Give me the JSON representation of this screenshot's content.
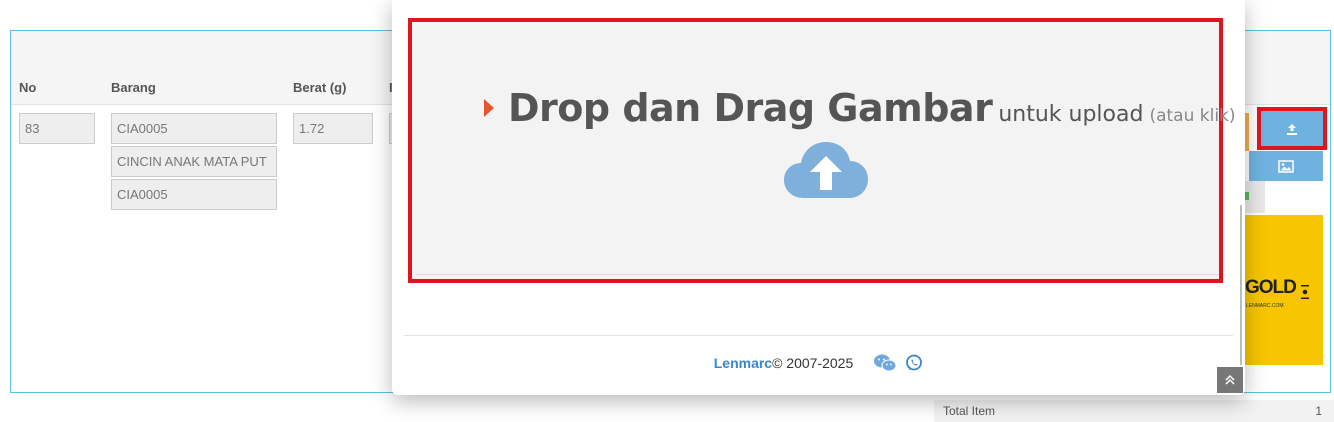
{
  "table": {
    "headers": [
      "No",
      "Barang",
      "Berat (g)",
      "I"
    ],
    "row": {
      "no": "83",
      "barang_code": "CIA0005",
      "barang_name": "CINCIN ANAK MATA PUT",
      "barang_code2": "CIA0005",
      "berat": "1.72"
    }
  },
  "gold_banner": {
    "text": "GOLD",
    "sub": "LENMARC.COM"
  },
  "summary": {
    "label": "Total Item",
    "value": "1"
  },
  "dropzone": {
    "title": "Drop dan Drag Gambar",
    "subtitle": "untuk upload",
    "hint": "(atau klik)",
    "icon": "cloud-upload-icon"
  },
  "footer": {
    "brand": "Lenmarc",
    "copyright": " © 2007-2025"
  },
  "colors": {
    "accent_blue": "#6fb2e0",
    "highlight_red": "#e0141e",
    "gold": "#f7c600",
    "arrow_orange": "#e8532f"
  }
}
